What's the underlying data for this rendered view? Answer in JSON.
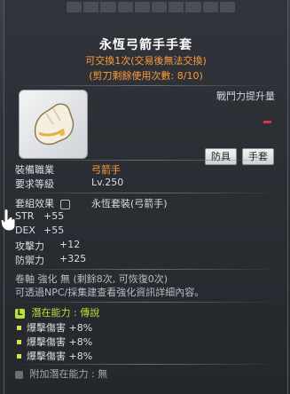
{
  "item": {
    "name": "永恆弓箭手手套",
    "trade_note": "可交換1次(交易後無法交換)",
    "scissors_note": "(剪刀剩餘使用次數: 8/10)",
    "combat_power_label": "戰鬥力提升量",
    "categories": [
      "防具",
      "手套"
    ]
  },
  "requirements": {
    "job_label": "裝備職業",
    "job_value": "弓箭手",
    "level_label": "要求等級",
    "level_value": "Lv.250"
  },
  "set": {
    "label": "套組效果",
    "value": "永恆套裝(弓箭手)"
  },
  "stats": [
    {
      "label": "STR",
      "value": "+55"
    },
    {
      "label": "DEX",
      "value": "+55"
    },
    {
      "label": "攻擊力",
      "value": "+12"
    },
    {
      "label": "防禦力",
      "value": "+325"
    }
  ],
  "upgrade": {
    "line1": "卷軸 強化 無 (剩餘8次, 可恢復0次)",
    "line2": "可透過NPC/採集建查看強化資訊詳細內容。"
  },
  "potential": {
    "badge": "L",
    "title": "潛在能力 : 傳說",
    "lines": [
      "爆擊傷害 +8%",
      "爆擊傷害 +8%",
      "爆擊傷害 +8%"
    ]
  },
  "additional": {
    "text": "附加潛在能力 : 無"
  },
  "colors": {
    "accent_orange": "#ff9a3a",
    "legendary_green": "#b8e23a"
  }
}
